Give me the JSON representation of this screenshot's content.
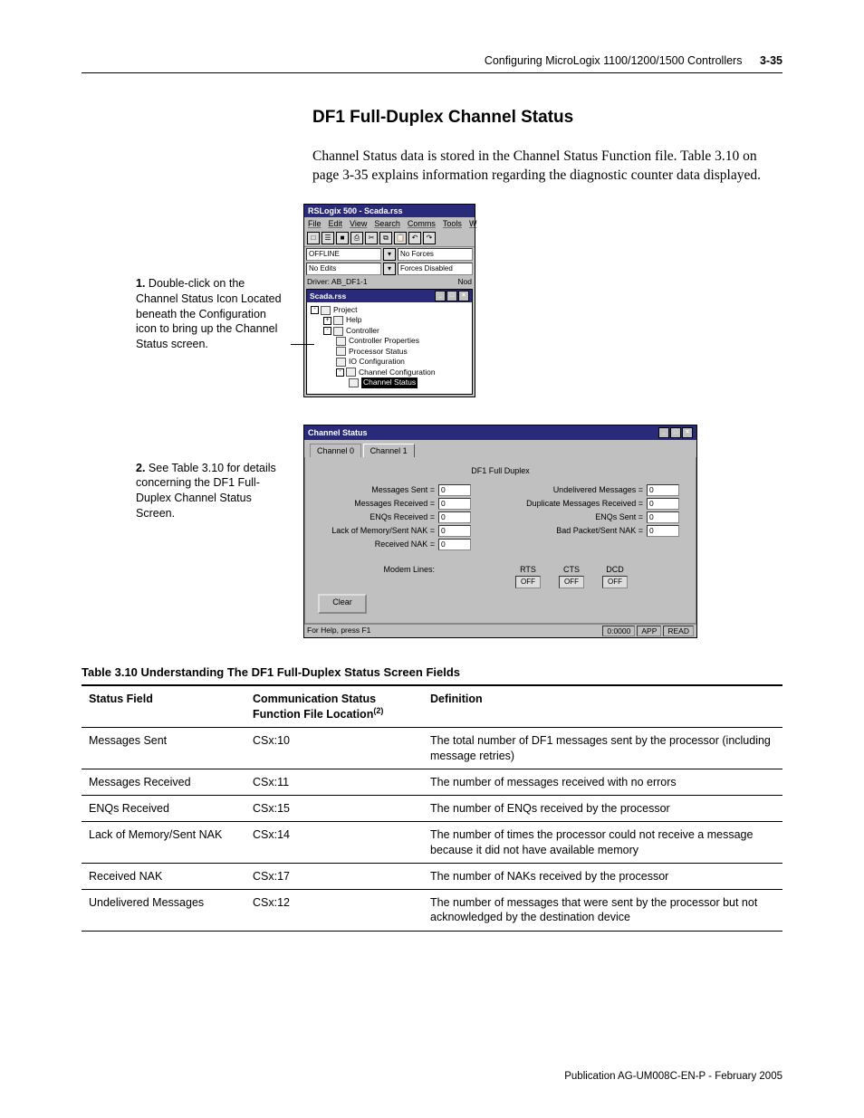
{
  "header": {
    "title": "Configuring MicroLogix 1100/1200/1500 Controllers",
    "page_number": "3-35"
  },
  "section": {
    "heading": "DF1 Full-Duplex Channel Status",
    "paragraph": "Channel Status data is stored in the Channel Status Function file. Table 3.10 on page 3-35 explains information regarding the diagnostic counter data displayed."
  },
  "steps": {
    "s1": {
      "num": "1.",
      "text": "Double-click on the Channel Status Icon Located beneath the Configuration icon to bring up the Channel Status screen."
    },
    "s2": {
      "num": "2.",
      "text": "See Table 3.10 for details concerning the DF1 Full-Duplex Channel Status Screen."
    }
  },
  "app1": {
    "title": "RSLogix 500 - Scada.rss",
    "menu": {
      "file": "File",
      "edit": "Edit",
      "view": "View",
      "search": "Search",
      "comms": "Comms",
      "tools": "Tools",
      "more": "W"
    },
    "status": {
      "offline": "OFFLINE",
      "noforces": "No Forces",
      "noedits": "No Edits",
      "forcesdisabled": "Forces Disabled"
    },
    "driver_label": "Driver: AB_DF1-1",
    "driver_right": "Nod",
    "subwin_title": "Scada.rss",
    "tree": {
      "project": "Project",
      "help": "Help",
      "controller": "Controller",
      "props": "Controller Properties",
      "proc": "Processor Status",
      "io": "IO Configuration",
      "chancfg": "Channel Configuration",
      "chanstat": "Channel Status"
    }
  },
  "app2": {
    "title": "Channel Status",
    "tabs": {
      "t0": "Channel 0",
      "t1": "Channel 1"
    },
    "panel_title": "DF1 Full Duplex",
    "left": {
      "l1": "Messages Sent =",
      "l2": "Messages Received =",
      "l3": "ENQs Received =",
      "l4": "Lack of Memory/Sent NAK =",
      "l5": "Received NAK ="
    },
    "right": {
      "r1": "Undelivered Messages =",
      "r2": "Duplicate Messages Received =",
      "r3": "ENQs Sent =",
      "r4": "Bad Packet/Sent NAK ="
    },
    "zero": "0",
    "modem": {
      "label": "Modem Lines:",
      "rts": "RTS",
      "cts": "CTS",
      "dcd": "DCD",
      "off": "OFF"
    },
    "clear": "Clear",
    "status": {
      "help": "For Help, press F1",
      "counter": "0:0000",
      "app": "APP",
      "read": "READ"
    }
  },
  "table": {
    "caption": "Table 3.10  Understanding The DF1 Full-Duplex Status Screen Fields",
    "head": {
      "c1": "Status Field",
      "c2a": "Communication Status",
      "c2b": "Function File Location",
      "c3": "Definition",
      "fn": "(2)"
    },
    "rows": [
      {
        "f": "Messages Sent",
        "loc": "CSx:10",
        "def": "The total number of DF1 messages sent by the processor (including message retries)"
      },
      {
        "f": "Messages Received",
        "loc": "CSx:11",
        "def": "The number of messages received with no errors"
      },
      {
        "f": "ENQs Received",
        "loc": "CSx:15",
        "def": "The number of ENQs received by the processor"
      },
      {
        "f": "Lack of Memory/Sent NAK",
        "loc": "CSx:14",
        "def": "The number of times the processor could not receive a message because it did not have available memory"
      },
      {
        "f": "Received NAK",
        "loc": "CSx:17",
        "def": "The number of NAKs received by the processor"
      },
      {
        "f": "Undelivered Messages",
        "loc": "CSx:12",
        "def": "The number of messages that were sent by the processor but not acknowledged by the destination device"
      }
    ]
  },
  "footer": {
    "pub": "Publication AG-UM008C-EN-P - February 2005"
  }
}
